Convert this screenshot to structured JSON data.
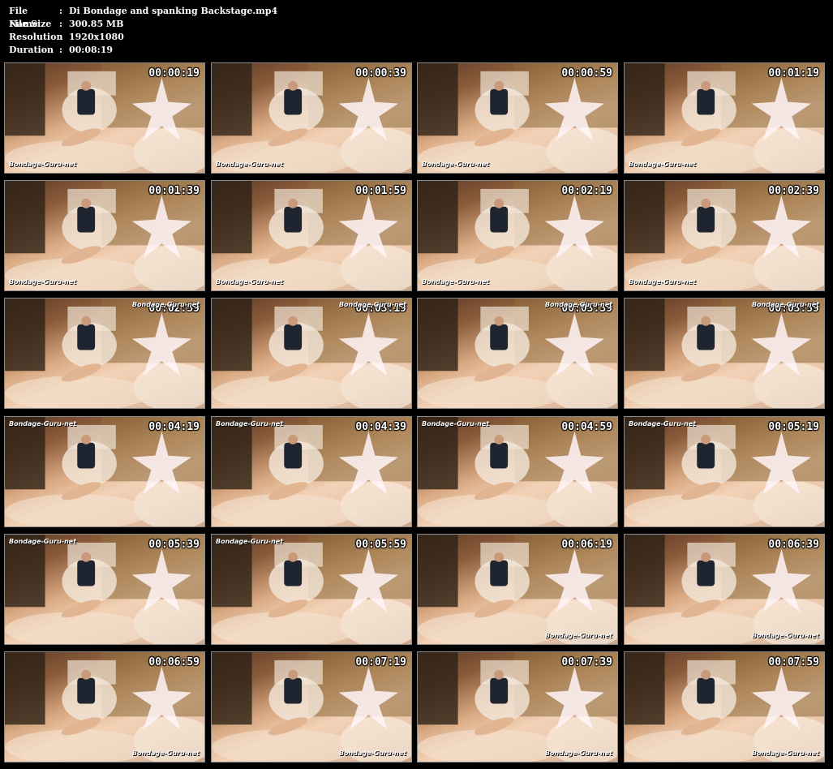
{
  "info": {
    "file_name_label": "File Name",
    "file_name": "Di Bondage and spanking Backstage.mp4",
    "file_size_label": "File Size",
    "file_size": "300.85 MB",
    "resolution_label": "Resolution",
    "resolution": "1920x1080",
    "duration_label": "Duration",
    "duration": "00:08:19",
    "separator": ":"
  },
  "watermark": "Bondage-Guru-net",
  "thumbnails": [
    {
      "time": "00:00:19",
      "wm": "bl"
    },
    {
      "time": "00:00:39",
      "wm": "bl"
    },
    {
      "time": "00:00:59",
      "wm": "bl"
    },
    {
      "time": "00:01:19",
      "wm": "bl"
    },
    {
      "time": "00:01:39",
      "wm": "bl"
    },
    {
      "time": "00:01:59",
      "wm": "bl"
    },
    {
      "time": "00:02:19",
      "wm": "bl"
    },
    {
      "time": "00:02:39",
      "wm": "bl"
    },
    {
      "time": "00:02:59",
      "wm": "tr"
    },
    {
      "time": "00:03:19",
      "wm": "tr"
    },
    {
      "time": "00:03:39",
      "wm": "tr"
    },
    {
      "time": "00:03:59",
      "wm": "tr"
    },
    {
      "time": "00:04:19",
      "wm": "tl"
    },
    {
      "time": "00:04:39",
      "wm": "tl"
    },
    {
      "time": "00:04:59",
      "wm": "tl"
    },
    {
      "time": "00:05:19",
      "wm": "tl"
    },
    {
      "time": "00:05:39",
      "wm": "tl"
    },
    {
      "time": "00:05:59",
      "wm": "tl"
    },
    {
      "time": "00:06:19",
      "wm": "br"
    },
    {
      "time": "00:06:39",
      "wm": "br"
    },
    {
      "time": "00:06:59",
      "wm": "br"
    },
    {
      "time": "00:07:19",
      "wm": "br"
    },
    {
      "time": "00:07:39",
      "wm": "br"
    },
    {
      "time": "00:07:59",
      "wm": "br"
    }
  ]
}
